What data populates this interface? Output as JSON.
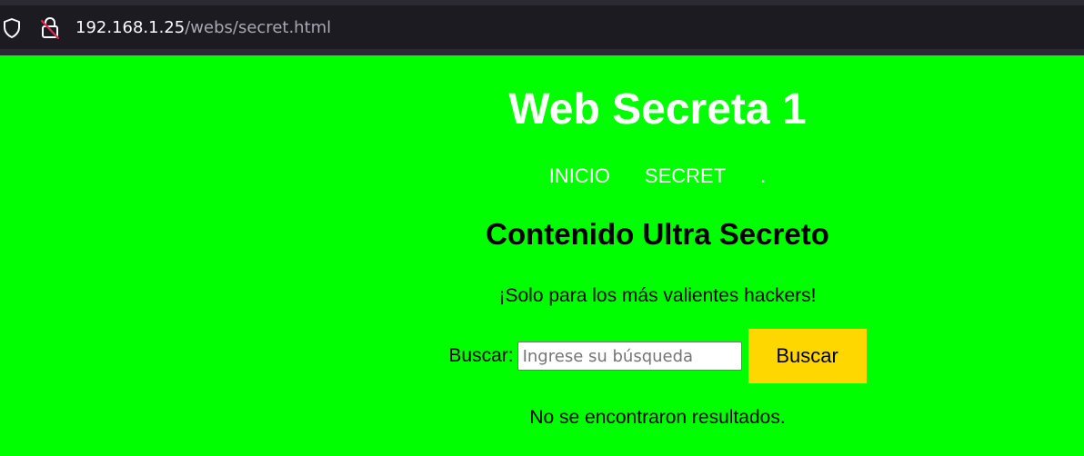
{
  "browser": {
    "url_host": "192.168.1.25",
    "url_path": "/webs/secret.html",
    "icons": [
      "shield-icon",
      "lock-insecure-icon"
    ]
  },
  "page": {
    "title": "Web Secreta 1",
    "nav": [
      {
        "label": "INICIO"
      },
      {
        "label": "SECRET"
      },
      {
        "label": "."
      }
    ],
    "heading": "Contenido Ultra Secreto",
    "tagline": "¡Solo para los más valientes hackers!",
    "search": {
      "label": "Buscar:",
      "placeholder": "Ingrese su búsqueda",
      "value": "",
      "button_label": "Buscar"
    },
    "results_message": "No se encontraron resultados."
  },
  "colors": {
    "page_background": "#00ff00",
    "title_text": "#ffffff",
    "button_background": "#ffd700",
    "browser_bar": "#1c1b22"
  }
}
